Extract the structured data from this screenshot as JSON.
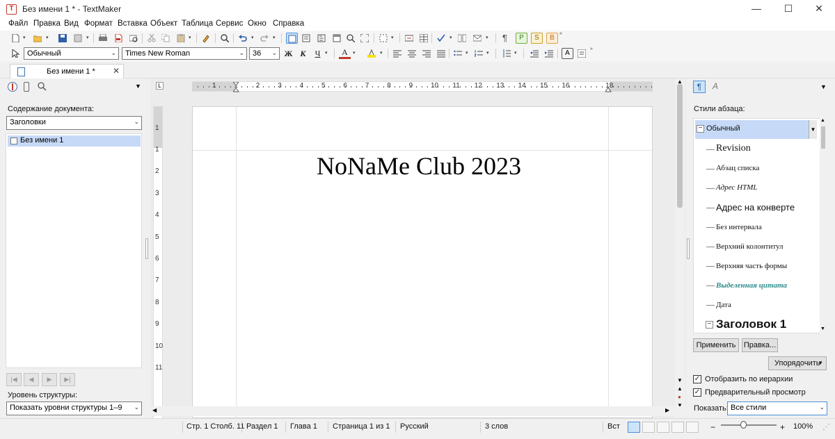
{
  "window": {
    "title": "Без имени 1 * - TextMaker",
    "app_icon_letter": "T",
    "minimize": "—",
    "maximize": "☐",
    "close": "✕"
  },
  "menu": [
    "Файл",
    "Правка",
    "Вид",
    "Формат",
    "Вставка",
    "Объект",
    "Таблица",
    "Сервис",
    "Окно",
    "Справка"
  ],
  "format_toolbar": {
    "paragraph_style": "Обычный",
    "font_name": "Times New Roman",
    "font_size": "36",
    "bold_label": "Ж",
    "italic_label": "К",
    "underline_label": "Ч",
    "font_color_label": "А"
  },
  "tabs": [
    {
      "label": "Без имени 1 *",
      "close": "✕"
    }
  ],
  "left_panel": {
    "contents_label": "Содержание документа:",
    "contents_filter": "Заголовки",
    "outline_items": [
      "Без имени 1"
    ],
    "outline_level_label": "Уровень структуры:",
    "outline_level_value": "Показать уровни структуры 1–9"
  },
  "ruler": {
    "h_numbers": [
      "1",
      "1",
      "2",
      "3",
      "4",
      "5",
      "6",
      "7",
      "8",
      "9",
      "10",
      "11",
      "12",
      "13",
      "14",
      "15",
      "16",
      "18"
    ],
    "v_numbers": [
      "1",
      "1",
      "2",
      "3",
      "4",
      "5",
      "6",
      "7",
      "8",
      "9",
      "10",
      "11"
    ],
    "corner_label": "L"
  },
  "document": {
    "heading": "NoNaMe Club 2023"
  },
  "right_panel": {
    "section_label": "Стили абзаца:",
    "styles": [
      "Обычный",
      "Revision",
      "Абзац списка",
      "Адрес HTML",
      "Адрес на конверте",
      "Без интервала",
      "Верхний колонтитул",
      "Верхняя часть формы",
      "Выделенная цитата",
      "Дата",
      "Заголовок 1"
    ],
    "apply_button": "Применить",
    "edit_button": "Правка...",
    "sort_button": "Упорядочить",
    "show_hierarchy_label": "Отобразить по иерархии",
    "preview_label": "Предварительный просмотр",
    "show_label": "Показать:",
    "show_value": "Все стили",
    "show_hierarchy_checked": true,
    "preview_checked": true
  },
  "status": {
    "position": "Стр. 1 Столб. 11",
    "section": "Раздел 1",
    "chapter": "Глава 1",
    "page": "Страница 1 из 1",
    "language": "Русский",
    "words": "3 слов",
    "mode": "Вст",
    "zoom": "100%",
    "zoom_minus": "−",
    "zoom_plus": "+"
  },
  "colors": {
    "selection": "#c6d9f7",
    "accent_blue": "#4a90d9",
    "quote_style": "#2e8b8b"
  }
}
